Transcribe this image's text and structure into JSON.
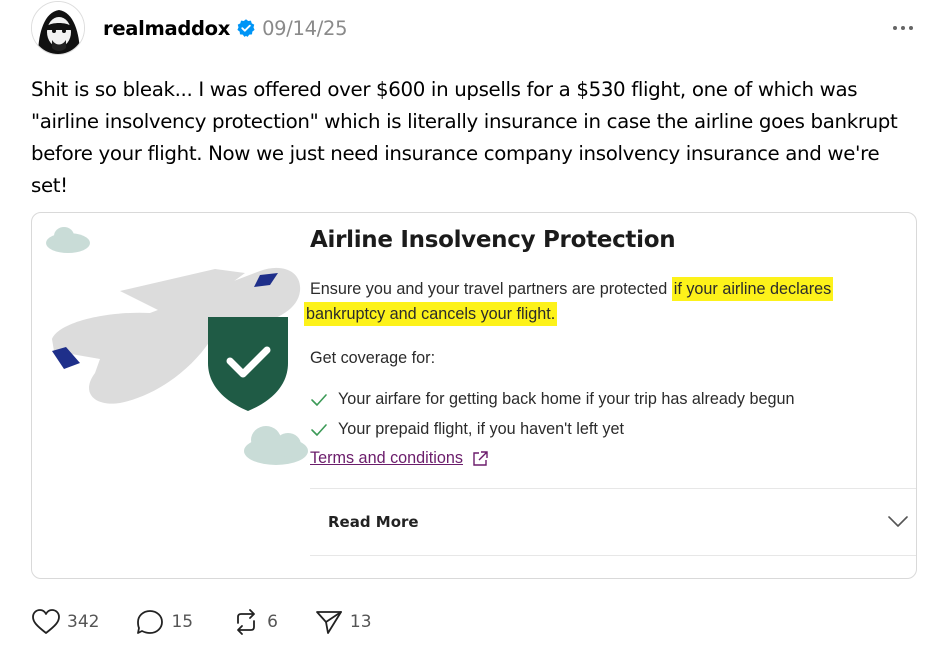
{
  "post": {
    "username": "realmaddox",
    "timestamp": "09/14/25",
    "text": "Shit is so bleak... I was offered over $600 in upsells for a $530 flight, one of which was \"airline insolvency protection\" which is literally insurance in case the airline goes bankrupt before your flight. Now we just need insurance company insolvency insurance and we're set!"
  },
  "card": {
    "title": "Airline Insolvency Protection",
    "description_plain": "Ensure you and your travel partners are protected ",
    "description_highlight_1": "if your airline declares",
    "description_highlight_2": "bankruptcy and cancels your flight.",
    "coverage_label": "Get coverage for:",
    "benefits": [
      "Your airfare for getting back home if your trip has already begun",
      "Your prepaid flight, if you haven't left yet"
    ],
    "terms_link": "Terms and conditions",
    "read_more": "Read More"
  },
  "actions": {
    "likes": "342",
    "replies": "15",
    "reposts": "6",
    "shares": "13"
  },
  "colors": {
    "highlight": "#fdf21a",
    "shield_green": "#1f5b45",
    "plane_gray": "#dcdcdc",
    "plane_navy": "#1e2f8a",
    "cloud": "#c9dcd7",
    "link_purple": "#6b1c6b",
    "verified_blue": "#0095f6"
  },
  "icons": [
    "verified-badge-icon",
    "more-icon",
    "shield-check-icon",
    "check-icon",
    "external-link-icon",
    "chevron-down-icon",
    "heart-icon",
    "reply-icon",
    "repost-icon",
    "share-icon"
  ]
}
